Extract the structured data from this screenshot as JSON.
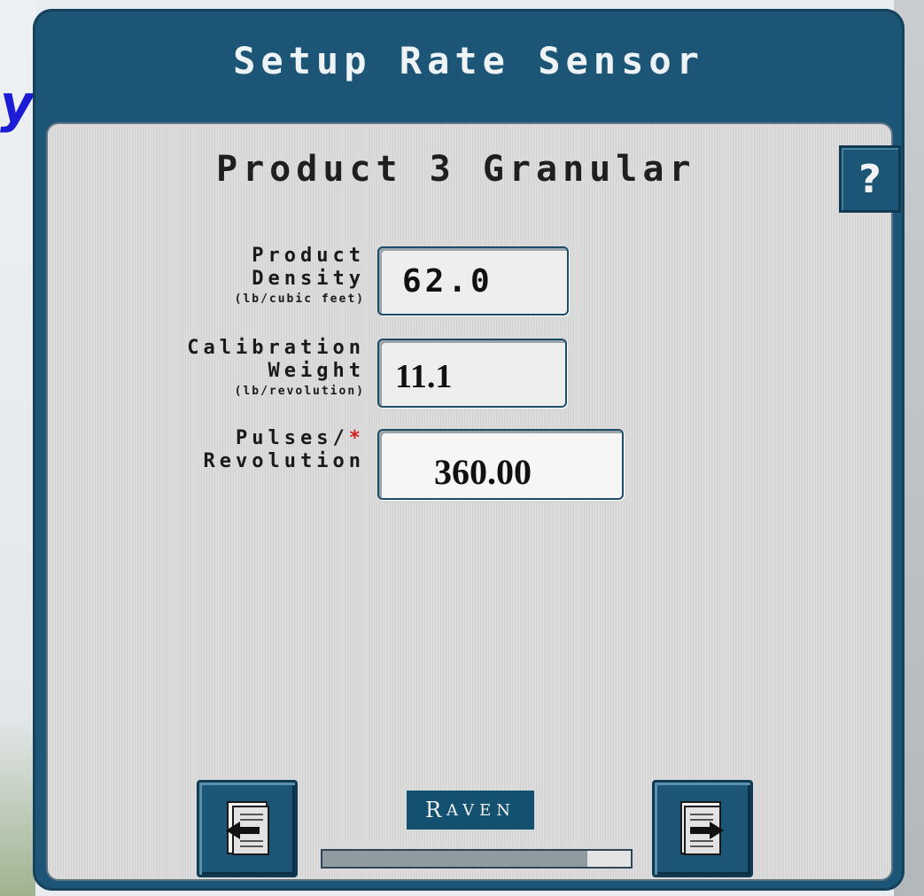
{
  "screen": {
    "title": "Setup Rate Sensor",
    "product_title": "Product 3 Granular",
    "help_label": "?"
  },
  "fields": {
    "density": {
      "label_line1": "Product",
      "label_line2": "Density",
      "unit": "(lb/cubic feet)",
      "value": "62.0"
    },
    "calibration_weight": {
      "label_line1": "Calibration",
      "label_line2": "Weight",
      "unit": "(lb/revolution)",
      "value": "11.1"
    },
    "pulses": {
      "label_line1": "Pulses/",
      "required_marker": "*",
      "label_line2": "Revolution",
      "value": "360.00"
    }
  },
  "footer": {
    "brand_initial": "R",
    "brand_rest": "AVEN",
    "progress_fraction": 0.86,
    "back_icon": "back-arrow-page-icon",
    "next_icon": "next-arrow-page-icon"
  },
  "colors": {
    "terminal_blue": "#1d5576",
    "panel_grey": "#d8d8d8",
    "required_red": "#d62020",
    "stray_glyph_blue": "#1c1cd6"
  },
  "stray_glyph": "y"
}
